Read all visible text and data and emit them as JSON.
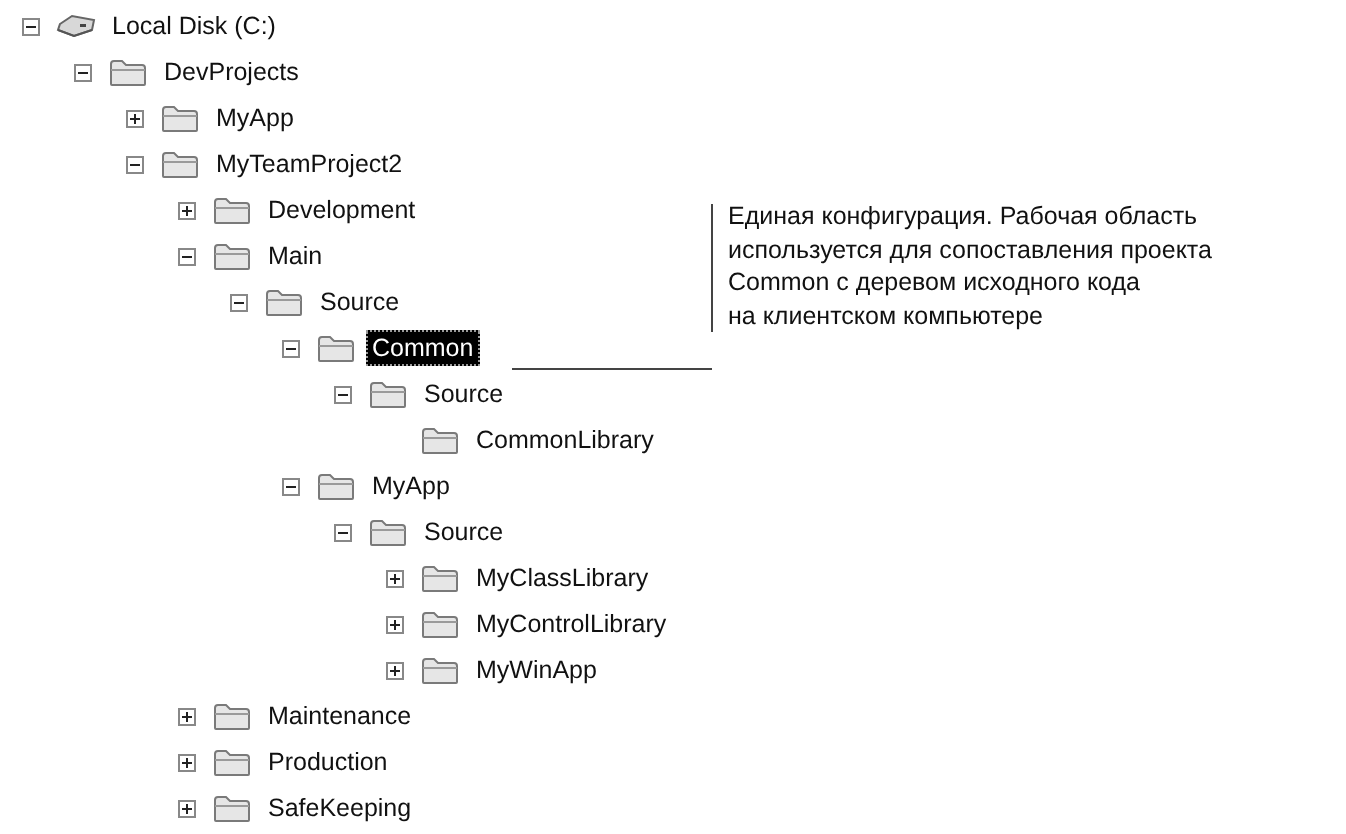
{
  "tree": [
    {
      "label": "Local Disk (C:)",
      "kind": "drive",
      "expanded": true,
      "selected": false,
      "children": [
        {
          "label": "DevProjects",
          "kind": "folder",
          "expanded": true,
          "selected": false,
          "children": [
            {
              "label": "MyApp",
              "kind": "folder",
              "expanded": false,
              "selected": false
            },
            {
              "label": "MyTeamProject2",
              "kind": "folder",
              "expanded": true,
              "selected": false,
              "children": [
                {
                  "label": "Development",
                  "kind": "folder",
                  "expanded": false,
                  "selected": false
                },
                {
                  "label": "Main",
                  "kind": "folder",
                  "expanded": true,
                  "selected": false,
                  "children": [
                    {
                      "label": "Source",
                      "kind": "folder",
                      "expanded": true,
                      "selected": false,
                      "children": [
                        {
                          "label": "Common",
                          "kind": "folder",
                          "expanded": true,
                          "selected": true,
                          "children": [
                            {
                              "label": "Source",
                              "kind": "folder",
                              "expanded": true,
                              "selected": false,
                              "children": [
                                {
                                  "label": "CommonLibrary",
                                  "kind": "folder",
                                  "selected": false
                                }
                              ]
                            }
                          ]
                        },
                        {
                          "label": "MyApp",
                          "kind": "folder",
                          "expanded": true,
                          "selected": false,
                          "children": [
                            {
                              "label": "Source",
                              "kind": "folder",
                              "expanded": true,
                              "selected": false,
                              "children": [
                                {
                                  "label": "MyClassLibrary",
                                  "kind": "folder",
                                  "expanded": false,
                                  "selected": false
                                },
                                {
                                  "label": "MyControlLibrary",
                                  "kind": "folder",
                                  "expanded": false,
                                  "selected": false
                                },
                                {
                                  "label": "MyWinApp",
                                  "kind": "folder",
                                  "expanded": false,
                                  "selected": false
                                }
                              ]
                            }
                          ]
                        }
                      ]
                    }
                  ]
                },
                {
                  "label": "Maintenance",
                  "kind": "folder",
                  "expanded": false,
                  "selected": false
                },
                {
                  "label": "Production",
                  "kind": "folder",
                  "expanded": false,
                  "selected": false
                },
                {
                  "label": "SafeKeeping",
                  "kind": "folder",
                  "expanded": false,
                  "selected": false
                }
              ]
            }
          ]
        }
      ]
    }
  ],
  "callout": {
    "lines": [
      "Единая конфигурация. Рабочая область",
      "используется для сопоставления проекта",
      "Common с деревом исходного кода",
      "на клиентском компьютере"
    ]
  }
}
